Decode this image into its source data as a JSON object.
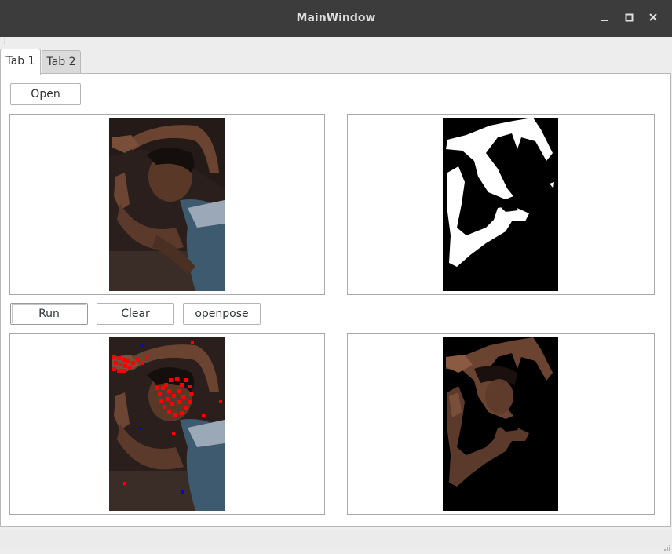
{
  "window": {
    "title": "MainWindow"
  },
  "tabs": [
    {
      "label": "Tab 1",
      "selected": true
    },
    {
      "label": "Tab 2",
      "selected": false
    }
  ],
  "toolbar": {
    "open_label": "Open",
    "run_label": "Run",
    "clear_label": "Clear",
    "openpose_label": "openpose"
  },
  "colors": {
    "titlebar": "#3c3c3c",
    "keypoint_red": "#ff0000",
    "keypoint_blue": "#0000ff",
    "mask_white": "#ffffff",
    "mask_black": "#000000"
  },
  "icons": {
    "minimize": "minimize-icon",
    "maximize": "maximize-icon",
    "close": "close-icon"
  }
}
